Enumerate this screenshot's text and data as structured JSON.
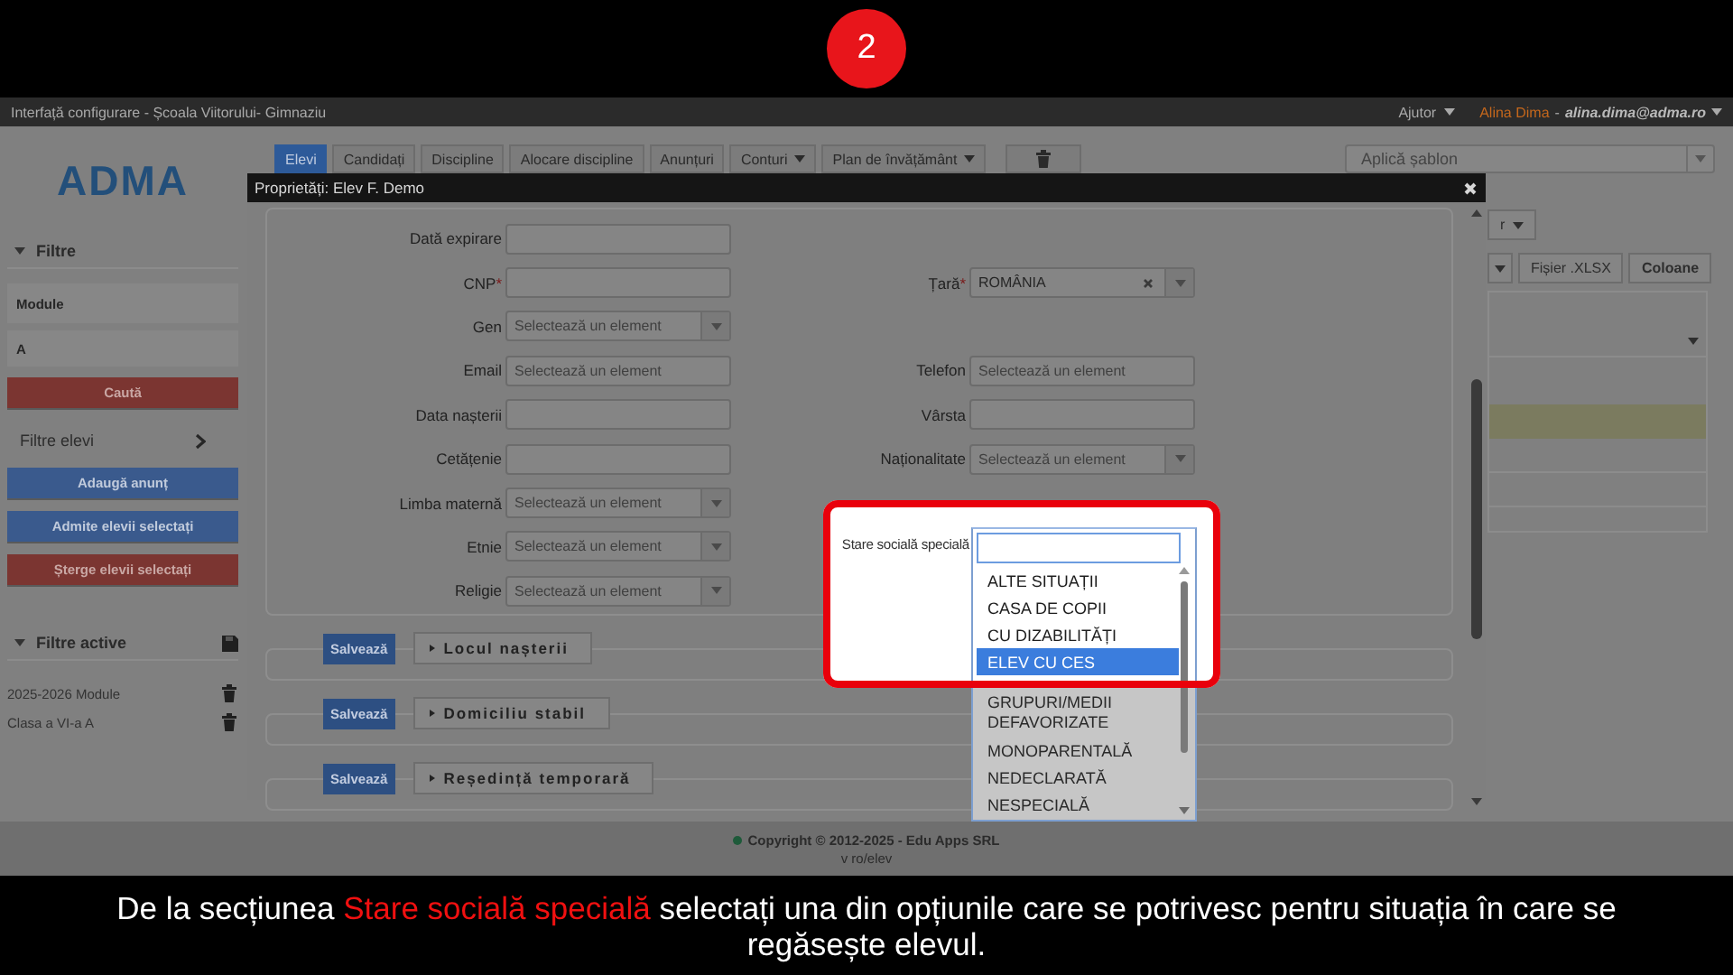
{
  "step": "2",
  "header": {
    "title": "Interfață configurare - Școala Viitorului- Gimnaziu",
    "help": "Ajutor",
    "user_name": "Alina Dima",
    "separator": "-",
    "user_email": "alina.dima@adma.ro"
  },
  "sidebar": {
    "logo": "ADMA",
    "filters_title": "Filtre",
    "module_field": "Module",
    "class_field": "A",
    "search_button": "Caută",
    "student_filters": "Filtre elevi",
    "actions": [
      {
        "label": "Adaugă anunț",
        "kind": "primary"
      },
      {
        "label": "Admite elevii selectați",
        "kind": "primary"
      },
      {
        "label": "Șterge elevii selectați",
        "kind": "danger"
      }
    ],
    "active_filters_title": "Filtre active",
    "active_filters": [
      "2025-2026 Module",
      "Clasa a VI-a A"
    ]
  },
  "nav": {
    "tabs": [
      {
        "label": "Elevi",
        "selected": true,
        "dropdown": false
      },
      {
        "label": "Candidați",
        "selected": false,
        "dropdown": false
      },
      {
        "label": "Discipline",
        "selected": false,
        "dropdown": false
      },
      {
        "label": "Alocare discipline",
        "selected": false,
        "dropdown": false
      },
      {
        "label": "Anunțuri",
        "selected": false,
        "dropdown": false
      },
      {
        "label": "Conturi",
        "selected": false,
        "dropdown": true
      },
      {
        "label": "Plan de învățământ",
        "selected": false,
        "dropdown": true
      }
    ],
    "template_select": {
      "placeholder": "Aplică șablon"
    }
  },
  "right_panel": {
    "partial_button": "r",
    "buttons": [
      "Fișier .XLSX",
      "Coloane"
    ]
  },
  "modal": {
    "title": "Proprietăți: Elev F. Demo",
    "rows": [
      {
        "left": {
          "label": "Dată expirare",
          "kind": "text"
        }
      },
      {
        "left": {
          "label": "CNP",
          "mark": "*",
          "kind": "text"
        },
        "right": {
          "label": "Țară",
          "mark": "*",
          "kind": "select",
          "value": "ROMÂNIA",
          "clearable": true
        }
      },
      {
        "left": {
          "label": "Gen",
          "kind": "select",
          "placeholder": "Selectează un element"
        }
      },
      {
        "left": {
          "label": "Email",
          "kind": "text",
          "placeholder": "Selectează un element"
        },
        "right": {
          "label": "Telefon",
          "kind": "text",
          "placeholder": "Selectează un element"
        }
      },
      {
        "left": {
          "label": "Data nașterii",
          "kind": "text"
        },
        "right": {
          "label": "Vârsta",
          "kind": "text"
        }
      },
      {
        "left": {
          "label": "Cetățenie",
          "kind": "text"
        },
        "right": {
          "label": "Naționalitate",
          "kind": "select",
          "placeholder": "Selectează un element"
        }
      },
      {
        "left": {
          "label": "Limba maternă",
          "kind": "select",
          "placeholder": "Selectează un element"
        }
      },
      {
        "left": {
          "label": "Etnie",
          "kind": "select",
          "placeholder": "Selectează un element"
        }
      },
      {
        "left": {
          "label": "Religie",
          "kind": "select",
          "placeholder": "Selectează un element"
        }
      }
    ],
    "sections": [
      {
        "save": "Salvează",
        "title": "Locul nașterii"
      },
      {
        "save": "Salvează",
        "title": "Domiciliu stabil"
      },
      {
        "save": "Salvează",
        "title": "Reședință temporară"
      }
    ],
    "special": {
      "label": "Stare socială specială",
      "options": [
        {
          "label": "ALTE SITUAȚII",
          "selected": false
        },
        {
          "label": "CASA DE COPII",
          "selected": false
        },
        {
          "label": "CU DIZABILITĂȚI",
          "selected": false
        },
        {
          "label": "ELEV CU CES",
          "selected": true
        },
        {
          "label": "GRUPURI/MEDII DEFAVORIZATE",
          "selected": false
        },
        {
          "label": "MONOPARENTALĂ",
          "selected": false
        },
        {
          "label": "NEDECLARATĂ",
          "selected": false
        },
        {
          "label": "NESPECIALĂ",
          "selected": false
        }
      ]
    }
  },
  "footer": {
    "copyright": "Copyright © 2012-2025 - Edu Apps SRL",
    "version": "v ro/elev"
  },
  "caption": {
    "before": "De la secțiunea",
    "highlight": "Stare socială specială",
    "after": "selectați una din opțiunile care se potrivesc pentru situația în care se regăsește elevul."
  }
}
